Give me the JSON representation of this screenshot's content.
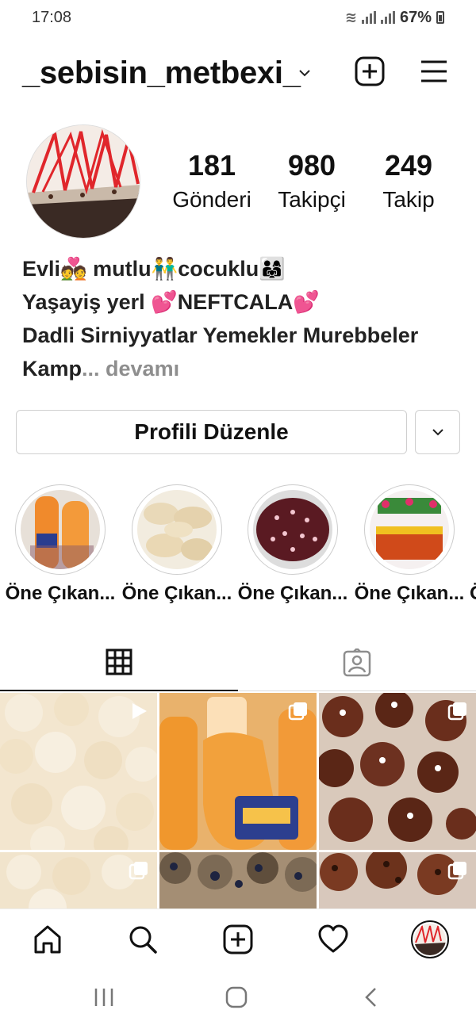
{
  "status_bar": {
    "time": "17:08",
    "battery": "67%"
  },
  "header": {
    "username": "_sebisin_metbexi_"
  },
  "stats": [
    {
      "value": "181",
      "label": "Gönderi"
    },
    {
      "value": "980",
      "label": "Takipçi"
    },
    {
      "value": "249",
      "label": "Takip"
    }
  ],
  "bio": {
    "line1": "Evli💑 mutlu👬cocuklu👨‍👩‍👧",
    "line2": "Yaşayiş yerl 💕NEFTCALA💕",
    "line3": "Dadli Sirniyyatlar Yemekler Murebbeler",
    "line4_start": "Kamp",
    "more_label": "... devamı"
  },
  "buttons": {
    "edit_profile": "Profili Düzenle"
  },
  "highlights": [
    {
      "label": "Öne Çıkan..."
    },
    {
      "label": "Öne Çıkan..."
    },
    {
      "label": "Öne Çıkan..."
    },
    {
      "label": "Öne Çıkan..."
    },
    {
      "label": "Ö"
    }
  ],
  "icons": {
    "dropdown": "chevron-down-icon",
    "new_post": "plus-square-icon",
    "menu": "hamburger-menu-icon",
    "grid_tab": "grid-icon",
    "tagged_tab": "tagged-person-icon",
    "home": "home-icon",
    "search": "search-icon",
    "add": "plus-square-icon",
    "activity": "heart-icon",
    "profile": "avatar"
  },
  "colors": {
    "text": "#262626",
    "muted": "#8e8e8e",
    "border": "#dbdbdb"
  }
}
